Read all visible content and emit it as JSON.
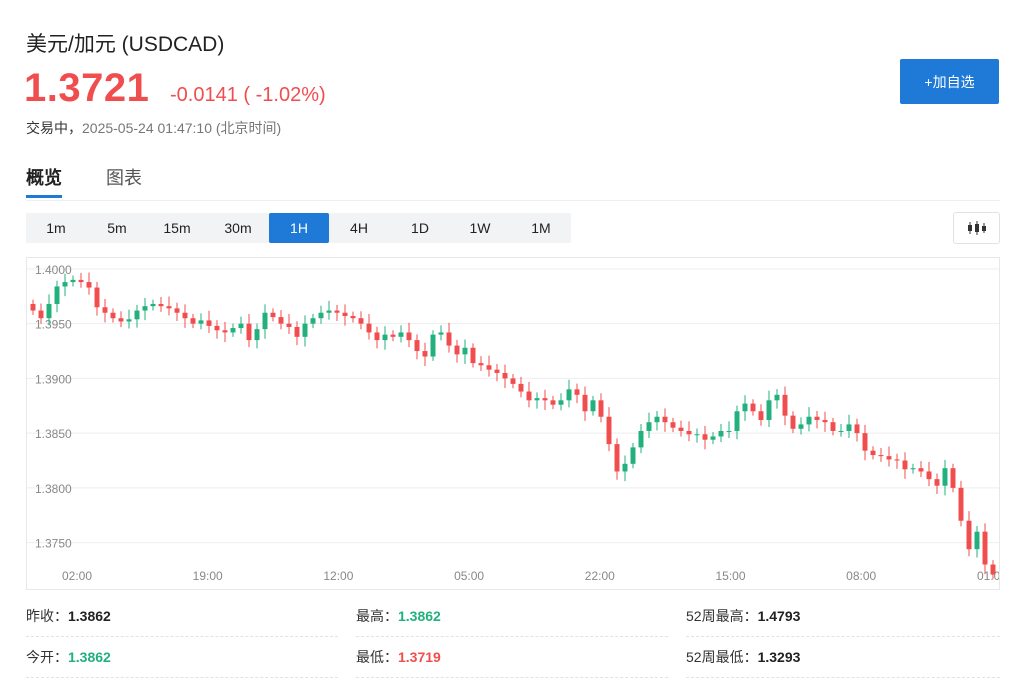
{
  "header": {
    "title": "美元/加元 (USDCAD)",
    "price": "1.3721",
    "change": "-0.0141 ( -1.02%)",
    "status_label": "交易中，",
    "timestamp": "2025-05-24 01:47:10",
    "timezone": "(北京时间)",
    "add_watchlist": "+加自选"
  },
  "tabs": [
    {
      "label": "概览",
      "active": true
    },
    {
      "label": "图表",
      "active": false
    }
  ],
  "periods": [
    {
      "label": "1m"
    },
    {
      "label": "5m"
    },
    {
      "label": "15m"
    },
    {
      "label": "30m"
    },
    {
      "label": "1H",
      "active": true
    },
    {
      "label": "4H"
    },
    {
      "label": "1D"
    },
    {
      "label": "1W"
    },
    {
      "label": "1M"
    }
  ],
  "colors": {
    "up": "#22b07d",
    "down": "#f04e4e",
    "accent": "#1e7ad6"
  },
  "chart_data": {
    "type": "candlestick",
    "y_ticks": [
      "1.4000",
      "1.3950",
      "1.3900",
      "1.3850",
      "1.3800",
      "1.3750"
    ],
    "y_tick_values": [
      1.4,
      1.395,
      1.39,
      1.385,
      1.38,
      1.375
    ],
    "x_ticks": [
      "02:00",
      "19:00",
      "12:00",
      "05:00",
      "22:00",
      "15:00",
      "08:00",
      "01:0"
    ],
    "ylim": [
      1.3725,
      1.401
    ],
    "grid": true,
    "closes": [
      1.3962,
      1.3955,
      1.3968,
      1.3984,
      1.3988,
      1.399,
      1.3988,
      1.3983,
      1.3965,
      1.396,
      1.3955,
      1.3952,
      1.3954,
      1.3962,
      1.3966,
      1.3968,
      1.3966,
      1.3964,
      1.396,
      1.3955,
      1.395,
      1.3953,
      1.3948,
      1.3944,
      1.3942,
      1.3946,
      1.395,
      1.3935,
      1.3945,
      1.396,
      1.3956,
      1.395,
      1.3947,
      1.3938,
      1.395,
      1.3955,
      1.396,
      1.3962,
      1.396,
      1.3957,
      1.3955,
      1.395,
      1.3942,
      1.3935,
      1.394,
      1.3938,
      1.3942,
      1.3935,
      1.3925,
      1.392,
      1.394,
      1.3942,
      1.393,
      1.3922,
      1.3928,
      1.3914,
      1.3912,
      1.3908,
      1.3905,
      1.39,
      1.3895,
      1.3888,
      1.388,
      1.3882,
      1.388,
      1.3876,
      1.388,
      1.389,
      1.3885,
      1.387,
      1.388,
      1.3865,
      1.384,
      1.3815,
      1.3822,
      1.3837,
      1.3852,
      1.386,
      1.3865,
      1.386,
      1.3855,
      1.3852,
      1.3849,
      1.3849,
      1.3844,
      1.3847,
      1.3852,
      1.3852,
      1.387,
      1.3877,
      1.387,
      1.3862,
      1.388,
      1.3885,
      1.3866,
      1.3854,
      1.3858,
      1.3865,
      1.3862,
      1.386,
      1.3852,
      1.3852,
      1.3858,
      1.385,
      1.3834,
      1.383,
      1.3829,
      1.3826,
      1.3825,
      1.3817,
      1.3818,
      1.3815,
      1.3808,
      1.3802,
      1.3818,
      1.38,
      1.377,
      1.3744,
      1.376,
      1.373,
      1.3721
    ]
  },
  "stats": [
    {
      "label": "昨收：",
      "value": "1.3862",
      "tone": "neutral"
    },
    {
      "label": "最高：",
      "value": "1.3862",
      "tone": "up"
    },
    {
      "label": "52周最高：",
      "value": "1.4793",
      "tone": "neutral"
    },
    {
      "label": "今开：",
      "value": "1.3862",
      "tone": "up"
    },
    {
      "label": "最低：",
      "value": "1.3719",
      "tone": "down"
    },
    {
      "label": "52周最低：",
      "value": "1.3293",
      "tone": "neutral"
    }
  ]
}
